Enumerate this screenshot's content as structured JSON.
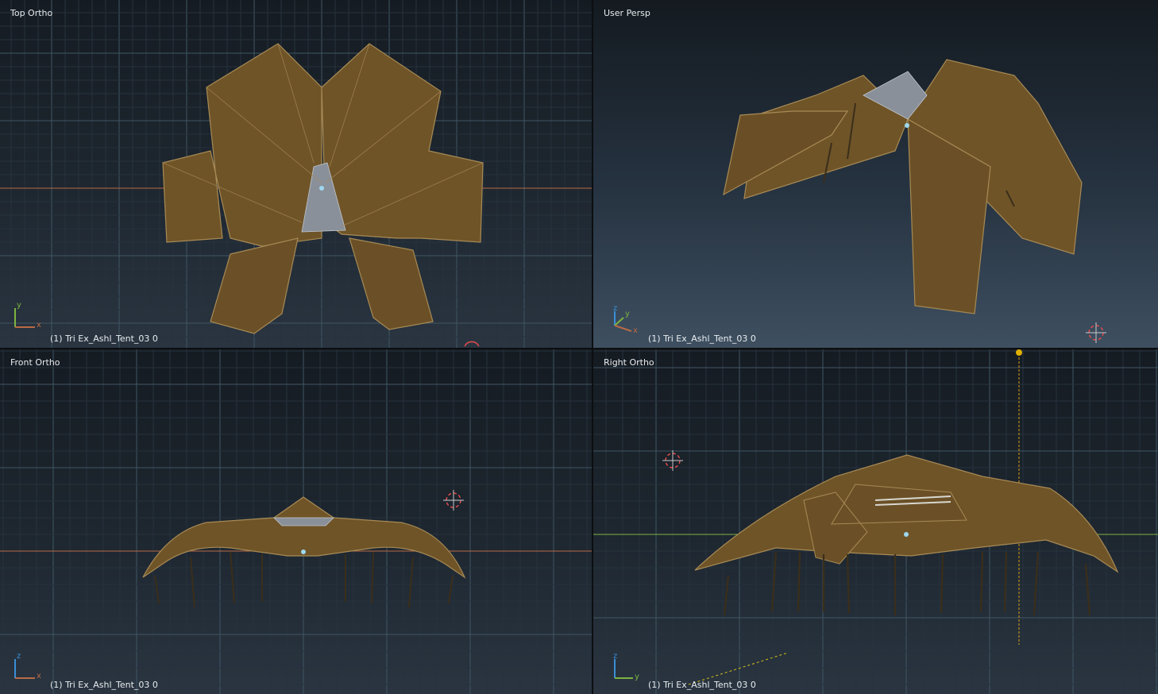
{
  "viewports": {
    "top": {
      "label": "Top Ortho",
      "object": "(1) Tri Ex_Ashl_Tent_03 0",
      "axes": [
        "y",
        "x"
      ]
    },
    "persp": {
      "label": "User Persp",
      "object": "(1) Tri Ex_Ashl_Tent_03 0",
      "axes": [
        "z",
        "y",
        "x"
      ]
    },
    "front": {
      "label": "Front Ortho",
      "object": "(1) Tri Ex_Ashl_Tent_03 0",
      "axes": [
        "z",
        "x"
      ]
    },
    "right": {
      "label": "Right Ortho",
      "object": "(1) Tri Ex_Ashl_Tent_03 0",
      "axes": [
        "z",
        "y"
      ]
    }
  },
  "colors": {
    "grid_minor": "#26323d",
    "grid_major": "#3f5663",
    "axis_x": "#b86a45",
    "axis_y": "#7db341",
    "axis_z": "#3a8fd6",
    "tent_fill": "#6f5428",
    "tent_edge": "#a78a55",
    "mesh_grey": "#8a9099",
    "origin_dot": "#9ed8ef",
    "cursor_red": "#e24c4c"
  }
}
